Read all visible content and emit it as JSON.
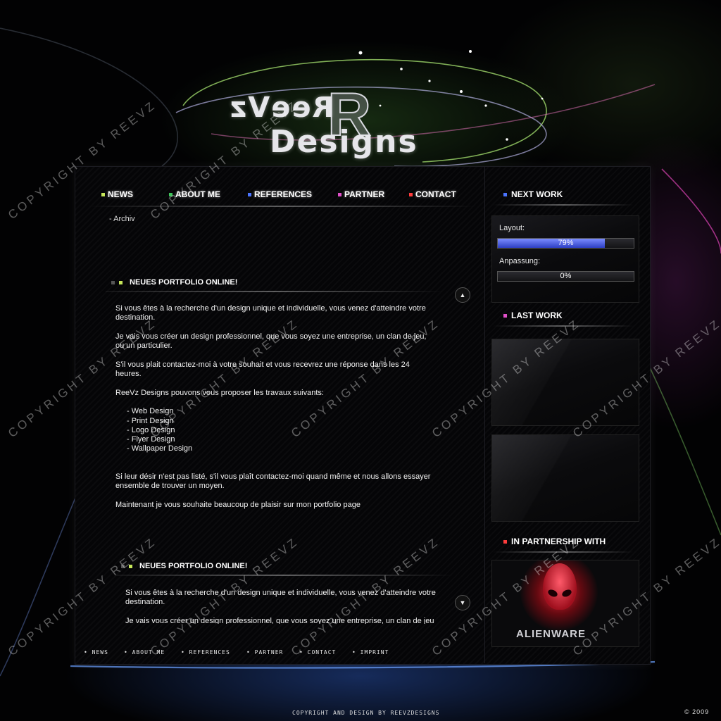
{
  "brand": {
    "logo_text": "ReeVz",
    "logo_suffix": "Designs"
  },
  "nav": {
    "items": [
      {
        "label": "NEWS",
        "color": "#c6e65a"
      },
      {
        "label": "ABOUT ME",
        "color": "#3fc45a"
      },
      {
        "label": "REFERENCES",
        "color": "#4a74ff"
      },
      {
        "label": "PARTNER",
        "color": "#e04fc8"
      },
      {
        "label": "CONTACT",
        "color": "#ff3c3c"
      }
    ],
    "archiv": "- Archiv"
  },
  "posts": [
    {
      "title": "NEUES PORTFOLIO ONLINE!",
      "p1": "Si vous êtes à la recherche d'un design unique et individuelle, vous venez d'atteindre votre destination.",
      "p2": "Je vais vous créer un design professionnel, que vous soyez une entreprise, un clan de jeu, ou un particulier.",
      "p3": "S'il vous plait contactez-moi à votre souhait et vous recevrez une réponse dans les 24 heures.",
      "p4": "ReeVz Designs pouvons vous proposer les travaux suivants:",
      "services": [
        "- Web Design",
        "- Print Design",
        "- Logo Design",
        "- Flyer Design",
        "- Wallpaper Design"
      ],
      "p5": "Si leur désir n'est pas listé, s'il vous plaît contactez-moi quand même et nous allons essayer ensemble de trouver un moyen.",
      "p6": "Maintenant je vous souhaite beaucoup de plaisir sur mon portfolio page"
    },
    {
      "title": "NEUES PORTFOLIO ONLINE!",
      "p1": "Si vous êtes à la recherche d'un design unique et individuelle, vous venez d'atteindre votre destination.",
      "p2": "Je vais vous créer un design professionnel, que vous soyez une entreprise, un clan de jeu"
    }
  ],
  "sidebar": {
    "next_work": {
      "title": "NEXT WORK",
      "layout_label": "Layout:",
      "layout_progress": 79,
      "layout_text": "79%",
      "anpassung_label": "Anpassung:",
      "anpassung_progress": 0,
      "anpassung_text": "0%"
    },
    "last_work": {
      "title": "LAST WORK"
    },
    "partnership": {
      "title": "IN PARTNERSHIP WITH",
      "partner_name": "ALIENWARE"
    }
  },
  "footer": {
    "links": [
      "• NEWS",
      "• ABOUT ME",
      "• REFERENCES",
      "• PARTNER",
      "• CONTACT",
      "• IMPRINT"
    ],
    "copyright": "COPYRIGHT AND DESIGN BY REEVZDESIGNS",
    "year": "© 2009"
  },
  "watermark": "COPYRIGHT BY REEVZ",
  "colors": {
    "accent_blue": "#4a74ff",
    "progress_fill": "#4f63e6",
    "background": "#000000"
  }
}
